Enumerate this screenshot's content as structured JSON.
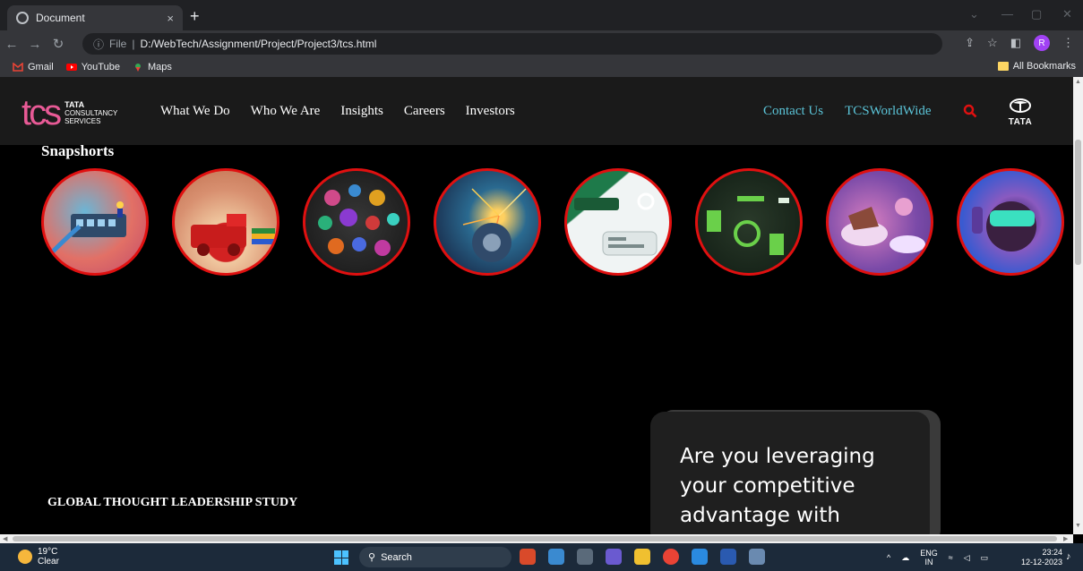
{
  "browser": {
    "tab_title": "Document",
    "tab_close": "×",
    "new_tab": "+",
    "omnibox_info": "ⓘ",
    "omnibox_scheme": "File",
    "omnibox_sep": "|",
    "omnibox_path": "D:/WebTech/Assignment/Project/Project3/tcs.html",
    "avatar_letter": "R",
    "bookmarks": [
      "Gmail",
      "YouTube",
      "Maps"
    ],
    "all_bookmarks": "All Bookmarks"
  },
  "site": {
    "logo_mark": "tcs",
    "logo_line1": "TATA",
    "logo_line2": "CONSULTANCY",
    "logo_line3": "SERVICES",
    "nav_links": [
      "What We Do",
      "Who We Are",
      "Insights",
      "Careers",
      "Investors"
    ],
    "nav_right": [
      "Contact Us",
      "TCSWorldWide"
    ],
    "tata_word": "TATA",
    "section_title": "Snapshorts",
    "snapshots": [
      "network-cables",
      "toy-truck",
      "colorful-dots",
      "welding-sparks",
      "chat-app",
      "circuit-board",
      "desserts",
      "vr-headset"
    ],
    "gtl_heading": "GLOBAL THOUGHT LEADERSHIP STUDY",
    "card_text": [
      "Are you leveraging",
      "your competitive",
      "advantage with"
    ]
  },
  "taskbar": {
    "weather_temp": "19°C",
    "weather_desc": "Clear",
    "search_label": "Search",
    "lang_top": "ENG",
    "lang_bottom": "IN",
    "time": "23:24",
    "date": "12-12-2023"
  },
  "colors": {
    "accent_red": "#e01010",
    "nav_cyan": "#5bc4d8",
    "tcs_pink": "#e85a96"
  }
}
